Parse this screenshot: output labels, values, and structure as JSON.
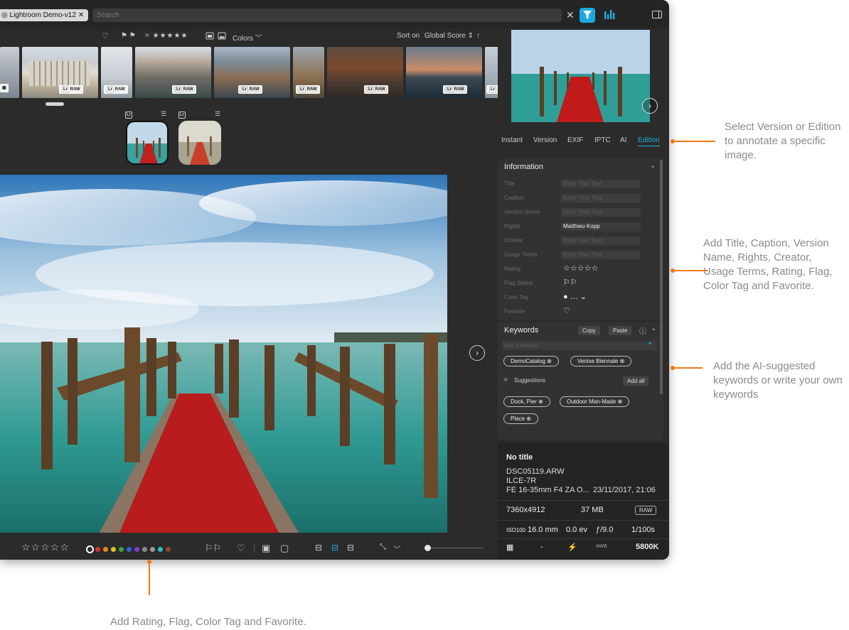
{
  "topbar": {
    "catalog_tag": "Lightroom Demo-v12",
    "search_placeholder": "Search"
  },
  "filter_row": {
    "flags": "⚑ ⚑",
    "rating_filter": "= ★★★★★",
    "colors_label": "Colors",
    "sort_label": "Sort on",
    "sort_value": "Global Score"
  },
  "strip": {
    "badges": [
      "RAW",
      "RAW",
      "RAW",
      "RAW",
      "RAW",
      "RAW",
      "RAW",
      "RAW"
    ]
  },
  "right_panel": {
    "tabs": [
      "Instant",
      "Version",
      "EXIF",
      "IPTC",
      "AI",
      "Edition"
    ],
    "active_tab": "Edition",
    "information": {
      "header": "Information",
      "fields": [
        {
          "label": "Title",
          "value": "Enter Your Text"
        },
        {
          "label": "Caption",
          "value": "Enter Your Text"
        },
        {
          "label": "Version Name",
          "value": "Enter Your Text"
        },
        {
          "label": "Rights",
          "value": "Matthieu Kopp"
        },
        {
          "label": "Creator",
          "value": "Enter Your Text"
        },
        {
          "label": "Usage Terms",
          "value": "Enter Your Text"
        }
      ],
      "rating_label": "Rating",
      "flag_label": "Flag Status",
      "color_label": "Color Tag",
      "favorite_label": "Favorite"
    },
    "keywords": {
      "header": "Keywords",
      "copy": "Copy",
      "paste": "Paste",
      "add_placeholder": "Add Keyword",
      "tags": [
        "DemoCatalog",
        "Venise Biennale"
      ],
      "suggestions_label": "Suggestions",
      "add_all": "Add all",
      "suggested": [
        "Dock, Pier",
        "Outdoor Man-Made",
        "Place"
      ]
    },
    "meta": {
      "title": "No title",
      "filename": "DSC05119.ARW",
      "camera": "ILCE-7R",
      "lens": "FE 16-35mm F4 ZA O...",
      "datetime": "23/11/2017, 21:06",
      "dimensions": "7360x4912",
      "filesize": "37 MB",
      "format": "RAW",
      "iso_label": "ISO",
      "iso": "100",
      "focal": "16.0 mm",
      "ev": "0.0 ev",
      "aperture": "ƒ/9.0",
      "shutter": "1/100s",
      "dash": "-",
      "wb_label": "AWB",
      "wb": "5800K"
    }
  },
  "annotations": {
    "edition": "Select Version or Edition to annotate a specific image.",
    "fields": "Add Title, Caption, Version Name, Rights, Creator, Usage Terms, Rating, Flag, Color Tag and Favorite.",
    "keywords": "Add the AI-suggested keywords or write your own keywords",
    "bottom": "Add Rating, Flag, Color Tag and Favorite."
  },
  "colors": {
    "accent": "#1ea8e0",
    "annotation_line": "#f07a14",
    "color_tags": [
      "#d7312e",
      "#e6862a",
      "#e4c21f",
      "#3aa446",
      "#2d63d6",
      "#7a3ed0",
      "#8c8c8c",
      "#9a9a9a",
      "#26c1c9",
      "#8a4b22"
    ]
  }
}
